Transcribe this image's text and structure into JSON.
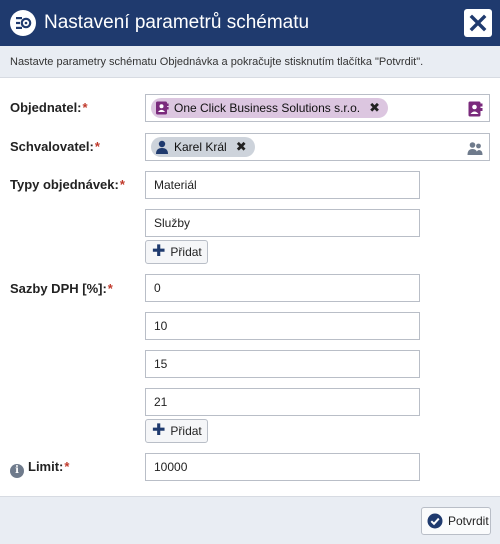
{
  "dialog": {
    "title": "Nastavení parametrů schématu",
    "close_icon": "close-icon",
    "header_icon": "settings-schema-icon",
    "info": "Nastavte parametry schématu Objednávka a pokračujte stisknutím tlačítka \"Potvrdit\"."
  },
  "colors": {
    "header_bg": "#1f3a6e",
    "company_tag": "#dcc6e0",
    "person_tag": "#cdd3db",
    "required": "#c0392b"
  },
  "form": {
    "required_mark": "*",
    "orderer": {
      "label": "Objednatel:",
      "tag": "One Click Business Solutions s.r.o.",
      "tag_icon": "company-contact-icon",
      "side_icon": "company-contact-icon"
    },
    "approver": {
      "label": "Schvalovatel:",
      "tag": "Karel Král",
      "tag_icon": "person-icon",
      "side_icon": "people-icon"
    },
    "order_types": {
      "label": "Typy objednávek:",
      "values": [
        "Materiál",
        "Služby"
      ],
      "add_label": "Přidat"
    },
    "vat_rates": {
      "label": "Sazby DPH [%]:",
      "values": [
        "0",
        "10",
        "15",
        "21"
      ],
      "add_label": "Přidat"
    },
    "limit": {
      "label": "Limit:",
      "value": "10000",
      "info_icon": "info-icon"
    }
  },
  "footer": {
    "confirm_label": "Potvrdit",
    "confirm_icon": "check-circle-icon"
  }
}
